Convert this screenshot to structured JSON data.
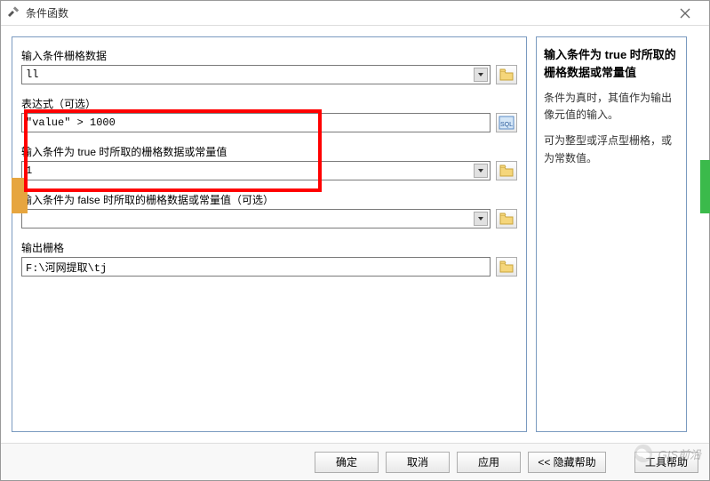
{
  "window": {
    "title": "条件函数"
  },
  "form": {
    "field1": {
      "label": "输入条件栅格数据",
      "value": "ll"
    },
    "field2": {
      "label": "表达式（可选）",
      "value": "\"value\" > 1000"
    },
    "field3": {
      "label": "输入条件为 true 时所取的栅格数据或常量值",
      "value": "1"
    },
    "field4": {
      "label": "输入条件为 false 时所取的栅格数据或常量值（可选）",
      "value": ""
    },
    "field5": {
      "label": "输出栅格",
      "value": "F:\\河网提取\\tj"
    }
  },
  "help": {
    "title": "输入条件为 true 时所取的栅格数据或常量值",
    "para1": "条件为真时，其值作为输出像元值的输入。",
    "para2": "可为整型或浮点型栅格，或为常数值。"
  },
  "buttons": {
    "ok": "确定",
    "cancel": "取消",
    "apply": "应用",
    "hideHelp": "<< 隐藏帮助",
    "toolHelp": "工具帮助"
  },
  "watermark": "GIS前沿"
}
